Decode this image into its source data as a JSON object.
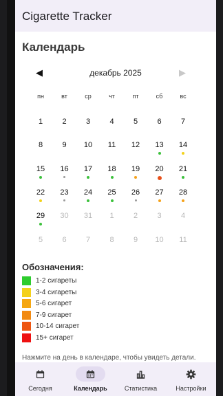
{
  "app": {
    "title": "Cigarette Tracker"
  },
  "page": {
    "title": "Календарь"
  },
  "calendar": {
    "month_label": "декабрь 2025",
    "weekdays": [
      "пн",
      "вт",
      "ср",
      "чт",
      "пт",
      "сб",
      "вс"
    ],
    "weeks": [
      [
        {
          "d": "1"
        },
        {
          "d": "2"
        },
        {
          "d": "3"
        },
        {
          "d": "4"
        },
        {
          "d": "5"
        },
        {
          "d": "6"
        },
        {
          "d": "7"
        }
      ],
      [
        {
          "d": "8"
        },
        {
          "d": "9"
        },
        {
          "d": "10"
        },
        {
          "d": "11"
        },
        {
          "d": "12"
        },
        {
          "d": "13",
          "dot": "green"
        },
        {
          "d": "14",
          "dot": "yellow"
        }
      ],
      [
        {
          "d": "15",
          "dot": "green"
        },
        {
          "d": "16",
          "dot": "gray"
        },
        {
          "d": "17",
          "dot": "green"
        },
        {
          "d": "18",
          "dot": "green"
        },
        {
          "d": "19",
          "dot": "orange"
        },
        {
          "d": "20",
          "dot": "red-orange",
          "big": true
        },
        {
          "d": "21",
          "dot": "green"
        }
      ],
      [
        {
          "d": "22",
          "dot": "yellow"
        },
        {
          "d": "23",
          "dot": "gray"
        },
        {
          "d": "24",
          "dot": "green"
        },
        {
          "d": "25",
          "dot": "green"
        },
        {
          "d": "26",
          "dot": "gray"
        },
        {
          "d": "27",
          "dot": "orange"
        },
        {
          "d": "28",
          "dot": "orange"
        }
      ],
      [
        {
          "d": "29",
          "dot": "green"
        },
        {
          "d": "30",
          "out": true
        },
        {
          "d": "31",
          "out": true
        },
        {
          "d": "1",
          "out": true
        },
        {
          "d": "2",
          "out": true
        },
        {
          "d": "3",
          "out": true
        },
        {
          "d": "4",
          "out": true
        }
      ],
      [
        {
          "d": "5",
          "out": true
        },
        {
          "d": "6",
          "out": true
        },
        {
          "d": "7",
          "out": true
        },
        {
          "d": "8",
          "out": true
        },
        {
          "d": "9",
          "out": true
        },
        {
          "d": "10",
          "out": true
        },
        {
          "d": "11",
          "out": true
        }
      ]
    ]
  },
  "dot_colors": {
    "green": "#3cc13c",
    "yellow": "#f2d21b",
    "orange": "#f5a21b",
    "red-orange": "#e8501a",
    "gray": "#9a9a9a"
  },
  "legend": {
    "title": "Обозначения:",
    "items": [
      {
        "label": "1-2 сигареты",
        "color": "#2ecc2e"
      },
      {
        "label": "3-4 сигареты",
        "color": "#f4d11c"
      },
      {
        "label": "5-6 сигарет",
        "color": "#f5a712"
      },
      {
        "label": "7-9 сигарет",
        "color": "#f28a12"
      },
      {
        "label": "10-14 сигарет",
        "color": "#ee5612"
      },
      {
        "label": "15+ сигарет",
        "color": "#ee1111"
      }
    ]
  },
  "hint": "Нажмите на день в календаре, чтобы увидеть детали.",
  "bottom_nav": {
    "items": [
      {
        "label": "Сегодня",
        "icon": "calendar-day-icon",
        "active": false
      },
      {
        "label": "Календарь",
        "icon": "calendar-month-icon",
        "active": true
      },
      {
        "label": "Статистика",
        "icon": "bar-chart-icon",
        "active": false
      },
      {
        "label": "Настройки",
        "icon": "gear-icon",
        "active": false
      }
    ]
  }
}
